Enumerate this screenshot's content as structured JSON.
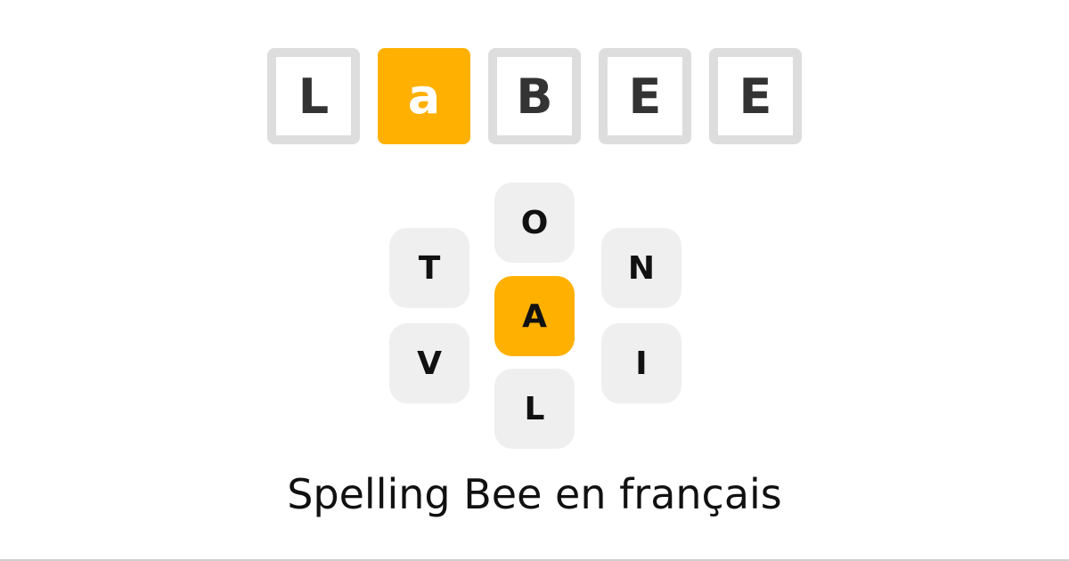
{
  "logo": {
    "tiles": [
      "L",
      "a",
      "B",
      "E",
      "E"
    ],
    "highlight_index": 1,
    "accent_color": "#ffb000",
    "outline_color": "#dddddd"
  },
  "board": {
    "center_letter": "A",
    "letters": {
      "top": "O",
      "upper_left": "T",
      "upper_right": "N",
      "lower_left": "V",
      "lower_right": "I",
      "bottom": "L"
    }
  },
  "caption": "Spelling Bee en français"
}
